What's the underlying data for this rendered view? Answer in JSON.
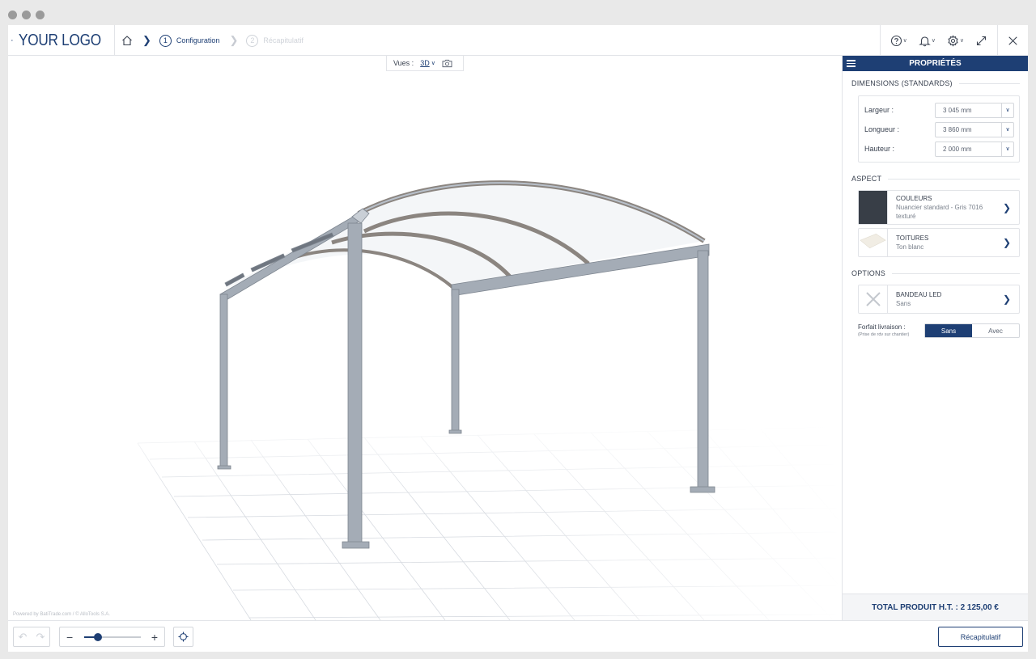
{
  "header": {
    "logo_text": "YOUR LOGO",
    "steps": [
      {
        "num": "1",
        "label": "Configuration"
      },
      {
        "num": "2",
        "label": "Récapitulatif"
      }
    ]
  },
  "views": {
    "label": "Vues :",
    "mode": "3D"
  },
  "viewport": {
    "powered_by": "Powered by BatiTrade.com / © AlloTools S.A."
  },
  "panel": {
    "title": "PROPRIÉTÉS",
    "dimensions": {
      "title": "DIMENSIONS (STANDARDS)",
      "rows": [
        {
          "label": "Largeur :",
          "value": "3 045 mm"
        },
        {
          "label": "Longueur :",
          "value": "3 860 mm"
        },
        {
          "label": "Hauteur :",
          "value": "2 000 mm"
        }
      ]
    },
    "aspect": {
      "title": "ASPECT",
      "couleurs": {
        "title": "COULEURS",
        "line1": "Nuancier standard - Gris 7016",
        "line2": "texturé",
        "swatch": "#383e47"
      },
      "toitures": {
        "title": "TOITURES",
        "line1": "Ton blanc"
      }
    },
    "options": {
      "title": "OPTIONS",
      "led": {
        "title": "BANDEAU LED",
        "line1": "Sans"
      },
      "forfait": {
        "label": "Forfait livraison :",
        "sub": "(Prise de rdv sur chantier)",
        "choices": [
          "Sans",
          "Avec"
        ],
        "selected": "Sans"
      }
    },
    "total": "TOTAL PRODUIT H.T. : 2 125,00 €"
  },
  "footer": {
    "recap_label": "Récapitulatif",
    "zoom_level": 0.25
  },
  "colors": {
    "brand": "#1e3f74",
    "frame": "#9aa3ae"
  }
}
